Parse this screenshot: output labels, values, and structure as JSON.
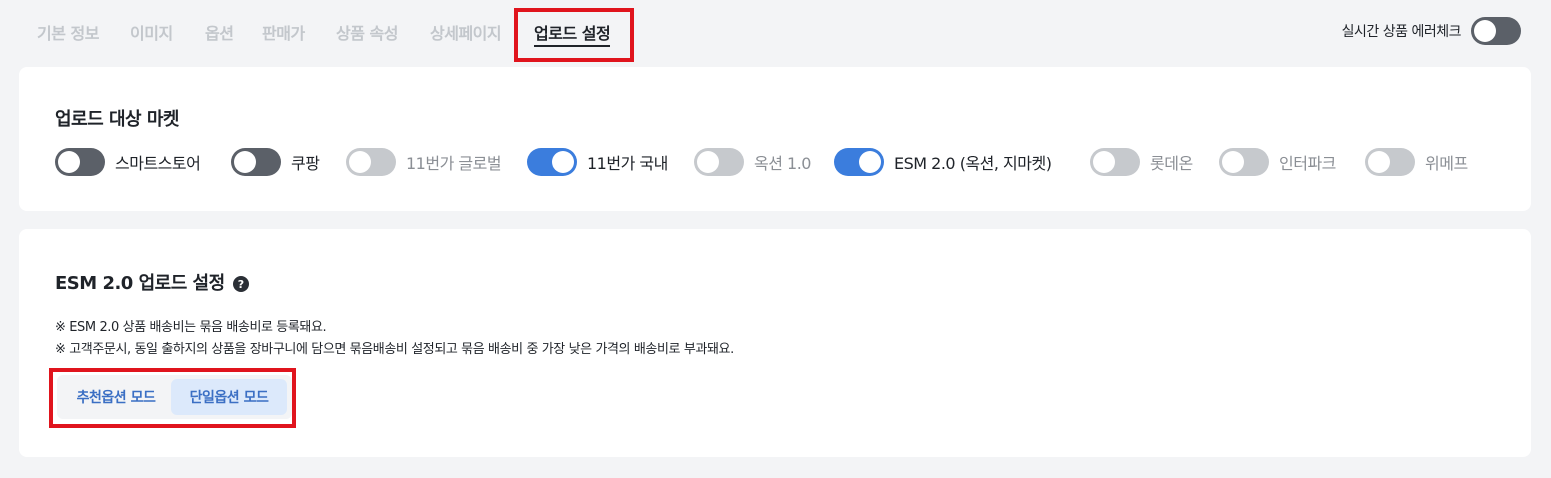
{
  "tabs": [
    {
      "label": "기본 정보",
      "active": false
    },
    {
      "label": "이미지",
      "active": false
    },
    {
      "label": "옵션",
      "active": false
    },
    {
      "label": "판매가",
      "active": false
    },
    {
      "label": "상품 속성",
      "active": false
    },
    {
      "label": "상세페이지",
      "active": false
    },
    {
      "label": "업로드 설정",
      "active": true
    }
  ],
  "error_check": {
    "label": "실시간 상품 에러체크",
    "enabled": false
  },
  "markets_section": {
    "title": "업로드 대상 마켓",
    "markets": [
      {
        "label": "스마트스토어",
        "state": "off",
        "available": true
      },
      {
        "label": "쿠팡",
        "state": "off",
        "available": true
      },
      {
        "label": "11번가 글로벌",
        "state": "off",
        "available": false
      },
      {
        "label": "11번가 국내",
        "state": "on",
        "available": true
      },
      {
        "label": "옥션 1.0",
        "state": "off",
        "available": false
      },
      {
        "label": "ESM 2.0 (옥션, 지마켓)",
        "state": "on",
        "available": true
      },
      {
        "label": "롯데온",
        "state": "off",
        "available": false
      },
      {
        "label": "인터파크",
        "state": "off",
        "available": false
      },
      {
        "label": "위메프",
        "state": "off",
        "available": false
      }
    ]
  },
  "esm_section": {
    "title": "ESM 2.0 업로드 설정",
    "help_icon": "?",
    "notes": [
      "※ ESM 2.0 상품 배송비는 묶음 배송비로 등록돼요.",
      "※ 고객주문시, 동일 출하지의 상품을 장바구니에 담으면 묶음배송비 설정되고 묶음 배송비 중 가장 낮은 가격의 배송비로 부과돼요."
    ],
    "modes": [
      {
        "label": "추천옵션 모드",
        "selected": false
      },
      {
        "label": "단일옵션 모드",
        "selected": true
      }
    ]
  },
  "colors": {
    "accent": "#3b7ddd",
    "highlight_box": "#e0141d",
    "mode_text": "#3b6fc4",
    "mode_selected_bg": "#dce9fb"
  }
}
